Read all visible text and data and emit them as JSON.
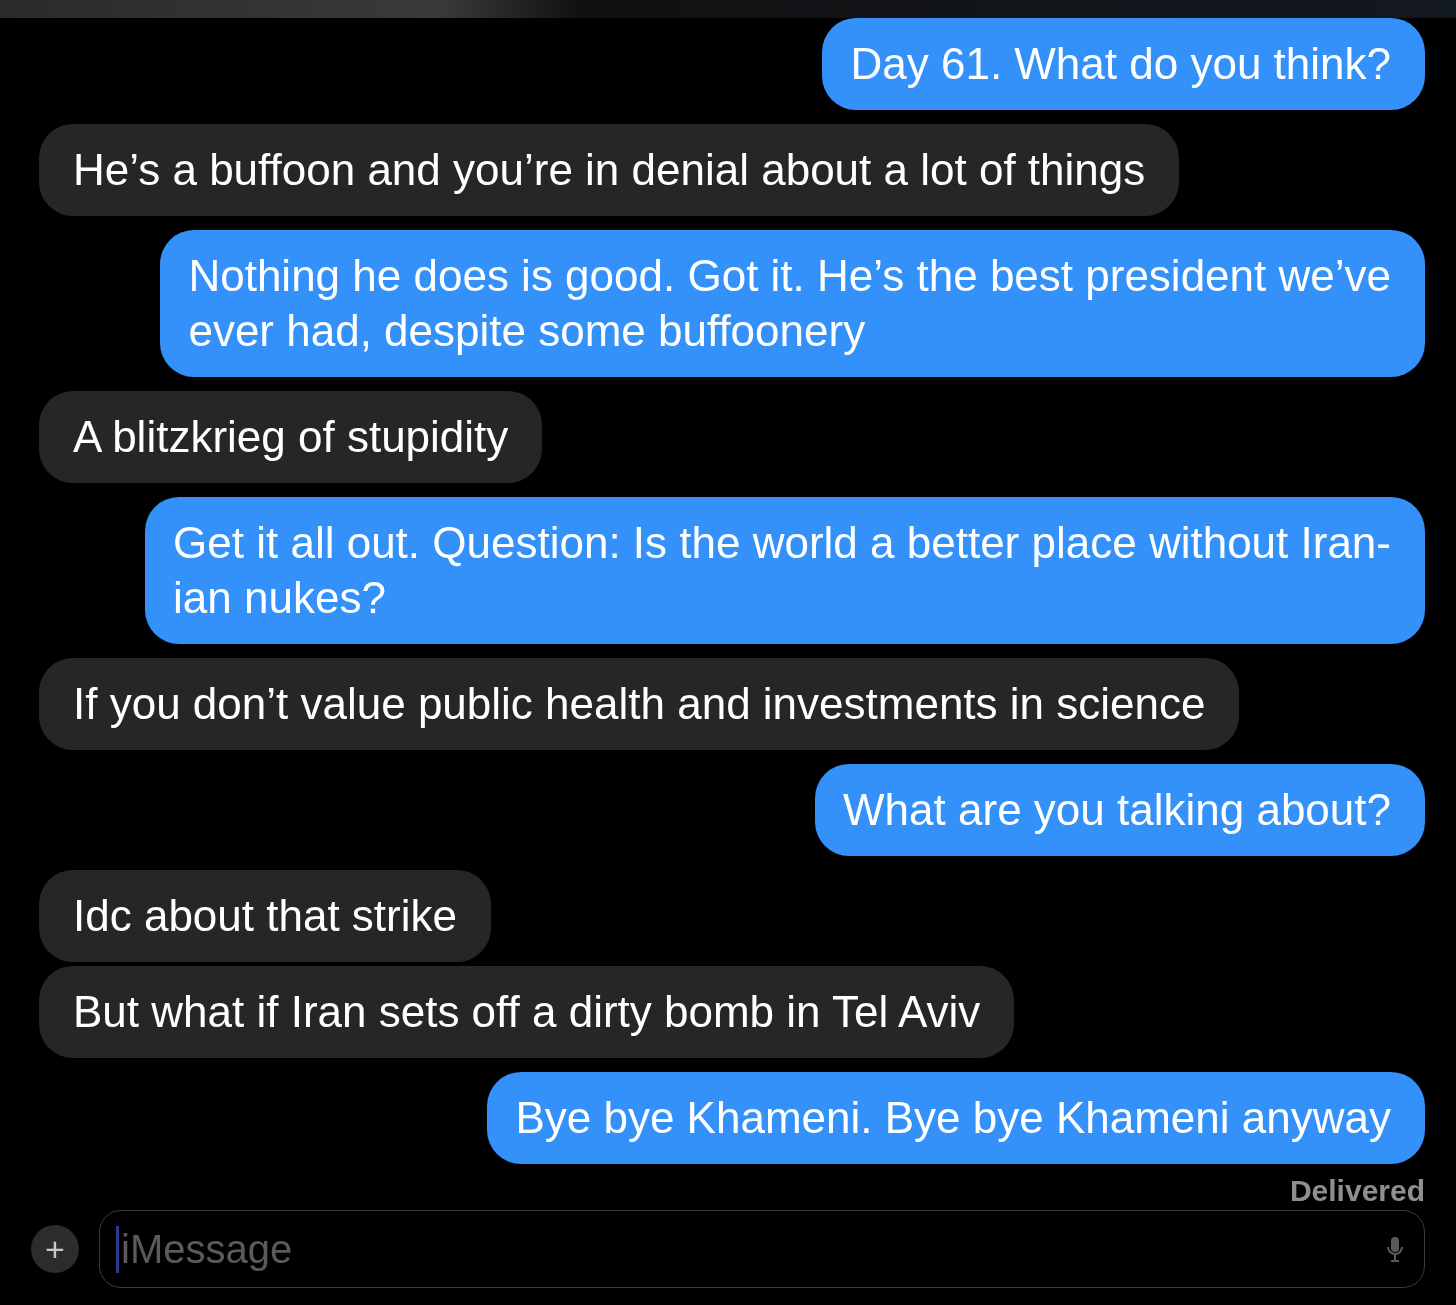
{
  "messages": [
    {
      "kind": "sent",
      "lines": [
        "Day 61. What do you think?"
      ]
    },
    {
      "kind": "received",
      "lines": [
        "He’s a buffoon and you’re in denial about a lot of things"
      ]
    },
    {
      "kind": "sent",
      "lines": [
        "Nothing he does is good. Got it. He’s the best president we’ve",
        "ever had, despite some buffoonery"
      ]
    },
    {
      "kind": "received",
      "lines": [
        "A blitzkrieg of stupidity"
      ]
    },
    {
      "kind": "sent",
      "lines": [
        "Get it all out. Question: Is the world a better place without Iran-",
        "ian nukes?"
      ]
    },
    {
      "kind": "received",
      "lines": [
        "If you don’t value public health and investments in science"
      ]
    },
    {
      "kind": "sent",
      "lines": [
        "What are you talking about?"
      ]
    },
    {
      "kind": "received",
      "lines": [
        "Idc about that strike"
      ]
    },
    {
      "kind": "received",
      "lines": [
        "But what if Iran sets off a dirty bomb in Tel Aviv"
      ]
    },
    {
      "kind": "sent",
      "lines": [
        "Bye bye Khameni. Bye bye Khameni anyway"
      ]
    }
  ],
  "status": "Delivered",
  "composer": {
    "add_button": "+",
    "placeholder": "iMessage"
  }
}
